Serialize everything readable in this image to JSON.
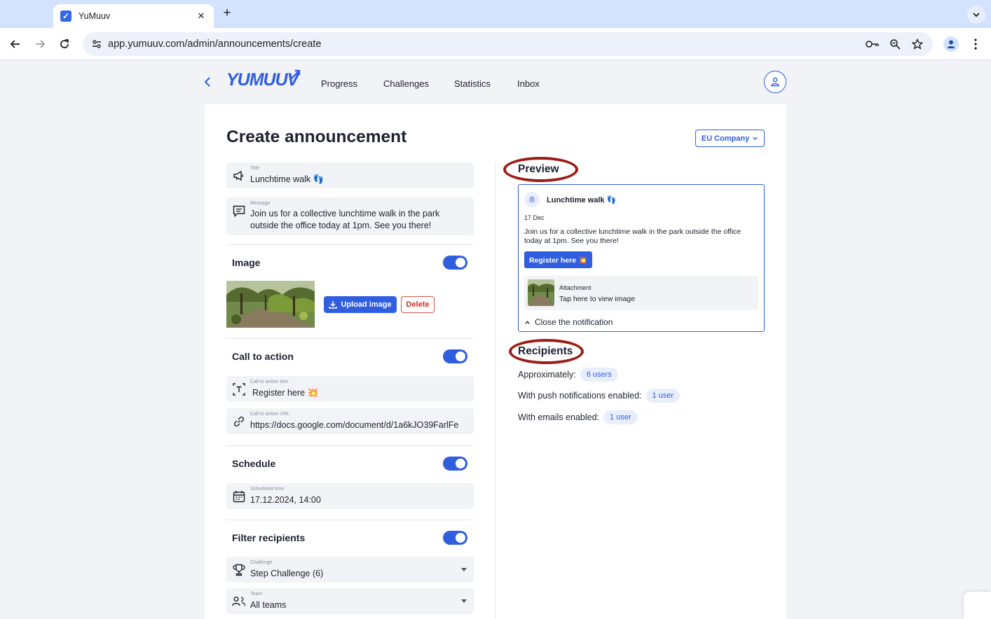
{
  "browser": {
    "tab_title": "YuMuuv",
    "tab_favicon": "✓",
    "tab_close": "✕",
    "new_tab": "+",
    "url": "app.yumuuv.com/admin/announcements/create",
    "icons": [
      "back-icon",
      "forward-icon",
      "reload-icon",
      "site-settings-icon",
      "password-key-icon",
      "zoom-icon",
      "bookmark-star-icon",
      "profile-icon",
      "menu-icon"
    ]
  },
  "header": {
    "logo": "YUMUUV",
    "nav": [
      "Progress",
      "Challenges",
      "Statistics",
      "Inbox"
    ]
  },
  "page": {
    "title": "Create announcement",
    "company": "EU Company"
  },
  "form": {
    "title_label": "Title",
    "title_value": "Lunchtime walk 👣",
    "message_label": "Message",
    "message_line1": "Join us for a collective lunchtime walk in the park",
    "message_line2": "outside the office today at 1pm. See you there!",
    "image": {
      "heading": "Image",
      "enabled": true,
      "upload_label": "Upload image",
      "delete_label": "Delete"
    },
    "cta": {
      "heading": "Call to action",
      "enabled": true,
      "text_label": "Call to action text",
      "text_value": "Register here 💥",
      "url_label": "Call to action URL",
      "url_value": "https://docs.google.com/document/d/1a6kJO39FarlFe"
    },
    "schedule": {
      "heading": "Schedule",
      "enabled": true,
      "label": "Scheduled time",
      "value": "17.12.2024, 14:00"
    },
    "filter": {
      "heading": "Filter recipients",
      "enabled": true,
      "challenge_label": "Challenge",
      "challenge_value": "Step Challenge (6)",
      "team_label": "Team",
      "team_value": "All teams"
    }
  },
  "preview": {
    "heading": "Preview",
    "title": "Lunchtime walk 👣",
    "date": "17 Dec",
    "message": "Join us for a collective lunchtime walk in the park outside the office today at 1pm. See you there!",
    "cta": "Register here 💥",
    "attachment_label": "Attachment",
    "attachment_sub": "Tap here to view image",
    "close": "Close the notification"
  },
  "recipients": {
    "heading": "Recipients",
    "approx_label": "Approximately:",
    "approx_value": "6 users",
    "push_label": "With push notifications enabled:",
    "push_value": "1 user",
    "email_label": "With emails enabled:",
    "email_value": "1 user"
  },
  "colors": {
    "accent": "#2f5ee0",
    "annotation_ring": "#9b1d16",
    "delete": "#c9302c"
  }
}
